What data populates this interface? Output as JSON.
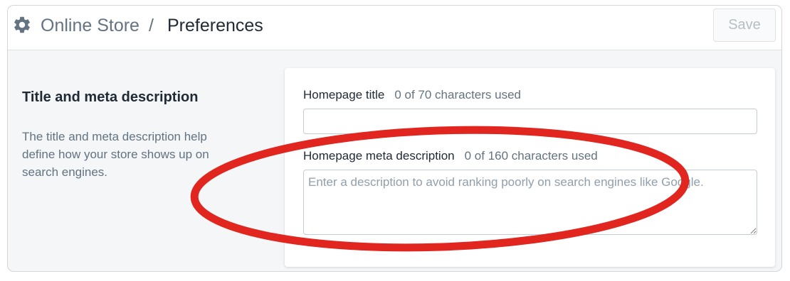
{
  "header": {
    "breadcrumb_parent": "Online Store",
    "separator": "/",
    "title": "Preferences",
    "save_label": "Save",
    "icon": "gear-icon"
  },
  "section": {
    "title": "Title and meta description",
    "description": "The title and meta description help define how your store shows up on search engines."
  },
  "form": {
    "homepage_title": {
      "label": "Homepage title",
      "counter": "0 of 70 characters used",
      "value": ""
    },
    "homepage_meta_description": {
      "label": "Homepage meta description",
      "counter": "0 of 160 characters used",
      "value": "",
      "placeholder": "Enter a description to avoid ranking poorly on search engines like Google."
    }
  },
  "colors": {
    "annotation_ring": "#e0261e",
    "panel_background": "#f4f6f8",
    "text_primary": "#212b36",
    "text_subdued": "#637381"
  }
}
